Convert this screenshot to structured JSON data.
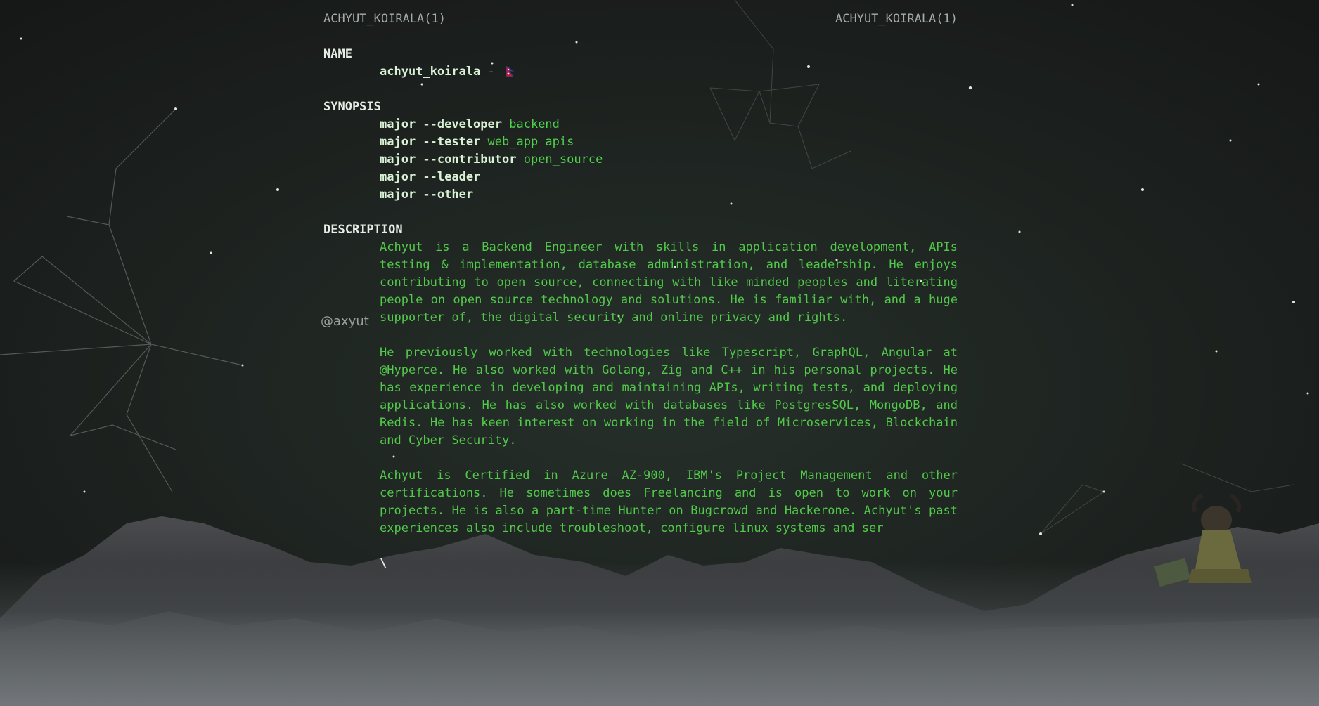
{
  "header": {
    "left": "ACHYUT_KOIRALA(1)",
    "right": "ACHYUT_KOIRALA(1)"
  },
  "name_section": {
    "title": "NAME",
    "name": "achyut_koirala",
    "separator": "-",
    "flag_icon": "nepal-flag-icon"
  },
  "synopsis": {
    "title": "SYNOPSIS",
    "lines": [
      {
        "cmd": "major --developer",
        "arg": "backend"
      },
      {
        "cmd": "major --tester",
        "arg": "web_app apis"
      },
      {
        "cmd": "major --contributor",
        "arg": "open_source"
      },
      {
        "cmd": "major --leader",
        "arg": ""
      },
      {
        "cmd": "major --other",
        "arg": ""
      }
    ]
  },
  "description": {
    "title": "DESCRIPTION",
    "paragraphs": [
      "Achyut is a Backend Engineer with skills in application development, APIs testing & implementation, database administration, and leadership. He enjoys contributing to open source, connecting with like minded peoples and literating people on open source technology and solutions. He is familiar with, and a huge supporter of, the digital security and online privacy and rights.",
      "He previously worked with technologies like Typescript, GraphQL, Angular at @Hyperce. He also worked with Golang, Zig and C++ in his personal projects. He has experience in developing and maintaining APIs, writing tests, and deploying applications. He has also worked with databases like PostgresSQL, MongoDB, and Redis. He has keen interest on working in the field of Microservices, Blockchain and Cyber Security.",
      "Achyut is Certified in Azure AZ-900, IBM's Project Management and other certifications. He sometimes does Freelancing and is open to work on your projects. He is also a part-time Hunter on Bugcrowd and Hackerone. Achyut's past experiences also include troubleshoot, configure linux systems and ser"
    ]
  },
  "handle": "@axyut",
  "cursor": "\\",
  "mascot_icon": "gnu-mascot-icon",
  "colors": {
    "accent": "#52c94a",
    "command": "#d9f2d6",
    "header": "#a7aca8"
  }
}
